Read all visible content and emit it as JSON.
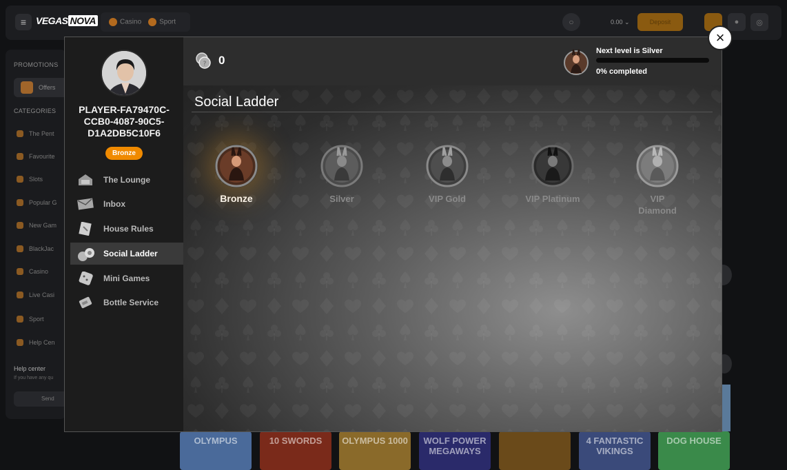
{
  "app": {
    "logo_text": "VEGAS",
    "logo_accent": "NOVA",
    "top_tabs": [
      "Casino",
      "Sport"
    ],
    "balance": "0.00",
    "deposit_label": "Deposit"
  },
  "sidebar": {
    "promotions_heading": "PROMOTIONS",
    "offers_label": "Offers",
    "categories_heading": "CATEGORIES",
    "categories": [
      "The Pent",
      "Favourite",
      "Slots",
      "Popular G",
      "New Gam",
      "BlackJac",
      "Casino",
      "Live Casi",
      "Sport",
      "Help Cen"
    ],
    "help_title": "Help center",
    "help_sub": "If you have any qu",
    "send_label": "Send"
  },
  "games": [
    "OLYMPUS",
    "10 SWORDS",
    "OLYMPUS 1000",
    "WOLF POWER MEGAWAYS",
    "",
    "4 FANTASTIC VIKINGS",
    "DOG HOUSE"
  ],
  "modal": {
    "player_id": "PLAYER-FA79470C-CCB0-4087-90C5-D1A2DB5C10F6",
    "tier_badge": "Bronze",
    "nav": [
      {
        "label": "The Lounge",
        "icon": "lounge-icon",
        "active": false
      },
      {
        "label": "Inbox",
        "icon": "inbox-icon",
        "active": false
      },
      {
        "label": "House Rules",
        "icon": "house-rules-icon",
        "active": false
      },
      {
        "label": "Social Ladder",
        "icon": "social-ladder-icon",
        "active": true
      },
      {
        "label": "Mini Games",
        "icon": "dice-icon",
        "active": false
      },
      {
        "label": "Bottle Service",
        "icon": "bottle-icon",
        "active": false
      }
    ],
    "coins": "0",
    "next_level_prefix": "Next level is ",
    "next_level_name": "Silver",
    "progress_percent_label": "0%",
    "progress_suffix": " completed",
    "progress_fraction": 0,
    "section_title": "Social Ladder",
    "tiers": [
      {
        "name": "Bronze",
        "current": true,
        "color": "#c8864a"
      },
      {
        "name": "Silver",
        "current": false,
        "color": "#8a8a8a"
      },
      {
        "name": "VIP Gold",
        "current": false,
        "color": "#9a9a9a"
      },
      {
        "name": "VIP Platinum",
        "current": false,
        "color": "#5a5a5a"
      },
      {
        "name": "VIP Diamond",
        "current": false,
        "color": "#a0a0a0"
      }
    ],
    "close_label": "×"
  },
  "colors": {
    "accent_orange": "#f08a00",
    "modal_bg": "#1c1c1c",
    "active_nav_bg": "#3a3a3a"
  }
}
